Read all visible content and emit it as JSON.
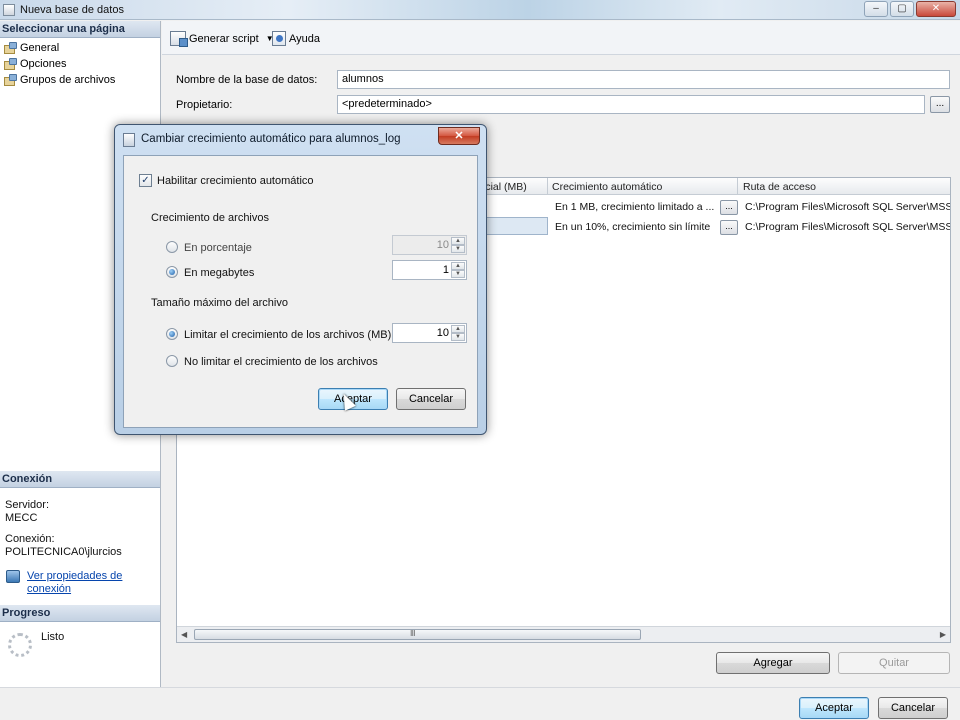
{
  "window": {
    "title": "Nueva base de datos",
    "min_label": "–",
    "max_label": "▢",
    "close_label": "✕"
  },
  "left": {
    "select_page_header": "Seleccionar una página",
    "pages": [
      "General",
      "Opciones",
      "Grupos de archivos"
    ],
    "connection_header": "Conexión",
    "server_label": "Servidor:",
    "server_value": "MECC",
    "connection_label": "Conexión:",
    "connection_value": "POLITECNICA0\\jlurcios",
    "view_props_link_line1": "Ver propiedades de",
    "view_props_link_line2": "conexión",
    "progress_header": "Progreso",
    "progress_status": "Listo"
  },
  "toolbar": {
    "generate_script": "Generar script",
    "dropdown_arrow": "▼",
    "help": "Ayuda"
  },
  "form": {
    "db_name_label": "Nombre de la base de datos:",
    "db_name_value": "alumnos",
    "owner_label": "Propietario:",
    "owner_value": "<predeterminado>",
    "ellipsis": "..."
  },
  "grid": {
    "columns": [
      "icial (MB)",
      "Crecimiento automático",
      "Ruta de acceso"
    ],
    "rows": [
      {
        "growth": "En 1 MB, crecimiento limitado a ...",
        "path": "C:\\Program Files\\Microsoft SQL Server\\MSSQ"
      },
      {
        "growth": "En un 10%, crecimiento sin límite",
        "path": "C:\\Program Files\\Microsoft SQL Server\\MSSQ"
      }
    ],
    "scroll_left": "◀",
    "scroll_right": "▶",
    "scroll_grip": "Ⅲ"
  },
  "buttons": {
    "add": "Agregar",
    "remove": "Quitar",
    "ok": "Aceptar",
    "cancel": "Cancelar"
  },
  "dialog": {
    "title": "Cambiar crecimiento automático para alumnos_log",
    "close_label": "✕",
    "enable_autogrowth": "Habilitar crecimiento automático",
    "enable_checked": "✓",
    "file_growth_label": "Crecimiento de archivos",
    "percent_label": "En porcentaje",
    "percent_value": "10",
    "megabytes_label": "En megabytes",
    "megabytes_value": "1",
    "max_size_label": "Tamaño máximo del archivo",
    "limit_label": "Limitar el crecimiento de los archivos (MB)",
    "limit_value": "10",
    "unlimited_label": "No limitar el crecimiento de los archivos",
    "ok": "Aceptar",
    "cancel": "Cancelar",
    "spin_up": "▲",
    "spin_down": "▼"
  }
}
